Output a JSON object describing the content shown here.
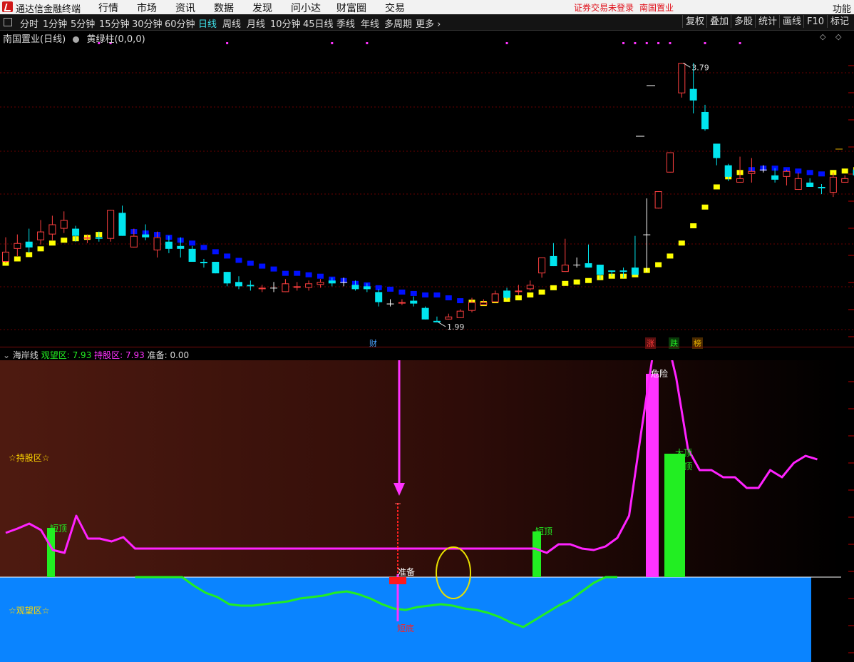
{
  "app": {
    "name": "通达信金融终端"
  },
  "menu": [
    "行情",
    "市场",
    "资讯",
    "数据",
    "发现",
    "问小达",
    "财富圈",
    "交易"
  ],
  "menu_right": {
    "notice": "证券交易未登录",
    "stock": "南国置业",
    "func": "功能"
  },
  "periods": [
    "分时",
    "1分钟",
    "5分钟",
    "15分钟",
    "30分钟",
    "60分钟",
    "日线",
    "周线",
    "月线",
    "10分钟",
    "45日线",
    "季线",
    "年线",
    "多周期",
    "更多"
  ],
  "selected_period": "日线",
  "toolbar_right": [
    "复权",
    "叠加",
    "多股",
    "统计",
    "画线",
    "F10",
    "标记"
  ],
  "main_header": {
    "title": "南国置业(日线)",
    "indicator": "黄绿柱(0,0,0)"
  },
  "price_labels": {
    "high": "3.79",
    "low": "1.99"
  },
  "events": [
    {
      "label": "财",
      "color": "#4aa3ff"
    },
    {
      "label": "涨",
      "color": "#ff3b3b"
    },
    {
      "label": "跌",
      "color": "#22dd22"
    },
    {
      "label": "榜",
      "color": "#e8b200"
    }
  ],
  "sub_header": {
    "name": "海岸线",
    "watch_label": "观望区:",
    "watch_value": "7.93",
    "hold_label": "持股区:",
    "hold_value": "7.93",
    "ready_label": "准备:",
    "ready_value": "0.00"
  },
  "sub_labels": {
    "hold_zone": "☆持股区☆",
    "watch_zone": "☆观望区☆",
    "danger": "危险",
    "short_top": "短顶",
    "big_top": "大顶",
    "mid_top": "中顶",
    "ready": "准备",
    "short_bottom": "短底"
  },
  "colors": {
    "bull": "#ff4040",
    "bear": "#00e5ee",
    "ma_up": "#ffff00",
    "ma_down": "#0010ff",
    "hold_line": "#ff22ff",
    "watch_line": "#22ee22",
    "watch_zone": "#0a84ff",
    "marker": "#ff33ff"
  },
  "chart_data": {
    "type": "candlestick",
    "price_range": [
      1.9,
      3.95
    ],
    "candles": [
      [
        2.41,
        2.48,
        2.58,
        2.4
      ],
      [
        2.5,
        2.54,
        2.6,
        2.45
      ],
      [
        2.55,
        2.51,
        2.64,
        2.47
      ],
      [
        2.56,
        2.62,
        2.7,
        2.53
      ],
      [
        2.6,
        2.67,
        2.73,
        2.56
      ],
      [
        2.64,
        2.7,
        2.76,
        2.61
      ],
      [
        2.64,
        2.59,
        2.66,
        2.55
      ],
      [
        2.57,
        2.58,
        2.6,
        2.54
      ],
      [
        2.58,
        2.57,
        2.62,
        2.55
      ],
      [
        2.57,
        2.77,
        2.77,
        2.55
      ],
      [
        2.75,
        2.59,
        2.8,
        2.59
      ],
      [
        2.51,
        2.59,
        2.64,
        2.51
      ],
      [
        2.6,
        2.58,
        2.67,
        2.56
      ],
      [
        2.49,
        2.58,
        2.62,
        2.44
      ],
      [
        2.55,
        2.5,
        2.59,
        2.47
      ],
      [
        2.52,
        2.5,
        2.58,
        2.44
      ],
      [
        2.5,
        2.41,
        2.52,
        2.41
      ],
      [
        2.41,
        2.4,
        2.43,
        2.37
      ],
      [
        2.41,
        2.33,
        2.41,
        2.33
      ],
      [
        2.34,
        2.26,
        2.34,
        2.24
      ],
      [
        2.27,
        2.24,
        2.31,
        2.22
      ],
      [
        2.25,
        2.24,
        2.28,
        2.21
      ],
      [
        2.22,
        2.23,
        2.25,
        2.2
      ],
      [
        2.23,
        2.23,
        2.27,
        2.2
      ],
      [
        2.2,
        2.26,
        2.29,
        2.2
      ],
      [
        2.23,
        2.24,
        2.27,
        2.21
      ],
      [
        2.23,
        2.26,
        2.28,
        2.21
      ],
      [
        2.25,
        2.27,
        2.29,
        2.23
      ],
      [
        2.28,
        2.26,
        2.3,
        2.24
      ],
      [
        2.27,
        2.27,
        2.3,
        2.24
      ],
      [
        2.25,
        2.22,
        2.28,
        2.21
      ],
      [
        2.24,
        2.22,
        2.26,
        2.2
      ],
      [
        2.2,
        2.13,
        2.22,
        2.1
      ],
      [
        2.12,
        2.12,
        2.15,
        2.1
      ],
      [
        2.12,
        2.13,
        2.15,
        2.11
      ],
      [
        2.14,
        2.12,
        2.17,
        2.1
      ],
      [
        2.09,
        2.01,
        2.1,
        2.01
      ],
      [
        2.0,
        1.99,
        2.03,
        1.99
      ],
      [
        2.01,
        2.03,
        2.05,
        2.01
      ],
      [
        2.02,
        2.07,
        2.08,
        2.02
      ],
      [
        2.07,
        2.13,
        2.16,
        2.06
      ],
      [
        2.11,
        2.13,
        2.15,
        2.11
      ],
      [
        2.13,
        2.19,
        2.21,
        2.13
      ],
      [
        2.21,
        2.16,
        2.23,
        2.15
      ],
      [
        2.2,
        2.21,
        2.25,
        2.18
      ],
      [
        2.22,
        2.25,
        2.28,
        2.21
      ],
      [
        2.33,
        2.44,
        2.44,
        2.3
      ],
      [
        2.45,
        2.38,
        2.54,
        2.38
      ],
      [
        2.34,
        2.39,
        2.57,
        2.34
      ],
      [
        2.39,
        2.39,
        2.44,
        2.37
      ],
      [
        2.4,
        2.37,
        2.53,
        2.37
      ],
      [
        2.39,
        2.32,
        2.39,
        2.29
      ],
      [
        2.35,
        2.34,
        2.35,
        2.31
      ],
      [
        2.35,
        2.34,
        2.37,
        2.3
      ],
      [
        2.37,
        2.32,
        2.59,
        2.32
      ],
      [
        2.6,
        2.6,
        2.85,
        2.34
      ],
      [
        2.78,
        2.9,
        2.9,
        2.78
      ],
      [
        3.03,
        3.17,
        3.17,
        3.03
      ],
      [
        3.58,
        3.79,
        3.79,
        3.55
      ],
      [
        3.61,
        3.53,
        3.79,
        3.44
      ],
      [
        3.45,
        3.33,
        3.5,
        3.32
      ],
      [
        3.23,
        3.13,
        3.18,
        3.08
      ],
      [
        3.08,
        3.0,
        3.09,
        2.97
      ],
      [
        2.96,
        2.99,
        3.14,
        2.96
      ],
      [
        3.02,
        3.04,
        3.13,
        2.96
      ],
      [
        3.05,
        3.05,
        3.08,
        3.03
      ],
      [
        3.01,
        2.98,
        3.06,
        2.96
      ],
      [
        3.0,
        3.04,
        3.05,
        2.94
      ],
      [
        2.91,
        2.99,
        3.03,
        2.91
      ],
      [
        2.96,
        2.93,
        2.99,
        2.93
      ],
      [
        2.93,
        2.92,
        2.95,
        2.88
      ],
      [
        2.89,
        3.0,
        3.03,
        2.86
      ],
      [
        2.96,
        2.99,
        3.01,
        2.96
      ],
      [
        3.05,
        3.01,
        3.08,
        2.96
      ]
    ],
    "indicator": [
      [
        2.4,
        0
      ],
      [
        2.43,
        0
      ],
      [
        2.46,
        0
      ],
      [
        2.5,
        0
      ],
      [
        2.54,
        0
      ],
      [
        2.56,
        0
      ],
      [
        2.57,
        0
      ],
      [
        2.58,
        0
      ],
      [
        2.6,
        0
      ],
      [
        2.62,
        0
      ],
      [
        2.62,
        1
      ],
      [
        2.62,
        1
      ],
      [
        2.61,
        1
      ],
      [
        2.6,
        1
      ],
      [
        2.58,
        1
      ],
      [
        2.56,
        1
      ],
      [
        2.54,
        1
      ],
      [
        2.51,
        1
      ],
      [
        2.48,
        1
      ],
      [
        2.45,
        1
      ],
      [
        2.42,
        1
      ],
      [
        2.4,
        1
      ],
      [
        2.38,
        1
      ],
      [
        2.36,
        1
      ],
      [
        2.33,
        1
      ],
      [
        2.33,
        1
      ],
      [
        2.32,
        1
      ],
      [
        2.31,
        1
      ],
      [
        2.29,
        1
      ],
      [
        2.28,
        1
      ],
      [
        2.26,
        1
      ],
      [
        2.25,
        1
      ],
      [
        2.23,
        1
      ],
      [
        2.22,
        1
      ],
      [
        2.2,
        1
      ],
      [
        2.19,
        1
      ],
      [
        2.18,
        1
      ],
      [
        2.18,
        1
      ],
      [
        2.16,
        1
      ],
      [
        2.14,
        1
      ],
      [
        2.13,
        0
      ],
      [
        2.12,
        0
      ],
      [
        2.14,
        0
      ],
      [
        2.15,
        0
      ],
      [
        2.16,
        0
      ],
      [
        2.18,
        0
      ],
      [
        2.2,
        0
      ],
      [
        2.23,
        0
      ],
      [
        2.26,
        0
      ],
      [
        2.27,
        0
      ],
      [
        2.28,
        0
      ],
      [
        2.3,
        0
      ],
      [
        2.31,
        0
      ],
      [
        2.31,
        0
      ],
      [
        2.32,
        0
      ],
      [
        2.35,
        0
      ],
      [
        2.39,
        0
      ],
      [
        2.45,
        0
      ],
      [
        2.54,
        0
      ],
      [
        2.66,
        0
      ],
      [
        2.79,
        0
      ],
      [
        2.93,
        0
      ],
      [
        3.0,
        0
      ],
      [
        3.03,
        0
      ],
      [
        3.05,
        1
      ],
      [
        3.06,
        1
      ],
      [
        3.06,
        1
      ],
      [
        3.05,
        1
      ],
      [
        3.04,
        1
      ],
      [
        3.03,
        1
      ],
      [
        3.02,
        1
      ],
      [
        3.03,
        0
      ],
      [
        3.04,
        0
      ],
      [
        3.05,
        0
      ]
    ],
    "hold_line": [
      62,
      68,
      75,
      66,
      38,
      34,
      86,
      54,
      54,
      50,
      56,
      40,
      40,
      40,
      40,
      40,
      40,
      40,
      40,
      40,
      40,
      40,
      40,
      40,
      40,
      40,
      40,
      40,
      40,
      40,
      40,
      40,
      40,
      40,
      40,
      40,
      40,
      40,
      40,
      40,
      40,
      40,
      40,
      40,
      40,
      40,
      34,
      46,
      46,
      40,
      38,
      43,
      55,
      86,
      200,
      310,
      350,
      280,
      180,
      150,
      150,
      140,
      140,
      125,
      125,
      150,
      140,
      160,
      170,
      165
    ],
    "watch_line": [
      0,
      0,
      0,
      0,
      0,
      -12,
      -22,
      -28,
      -38,
      -40,
      -40,
      -38,
      -36,
      -34,
      -30,
      -28,
      -26,
      -22,
      -20,
      -24,
      -30,
      -38,
      -44,
      -46,
      -42,
      -40,
      -38,
      -40,
      -44,
      -46,
      -50,
      -56,
      -64,
      -70,
      -60,
      -50,
      -40,
      -32,
      -20,
      -8,
      0,
      0
    ]
  }
}
